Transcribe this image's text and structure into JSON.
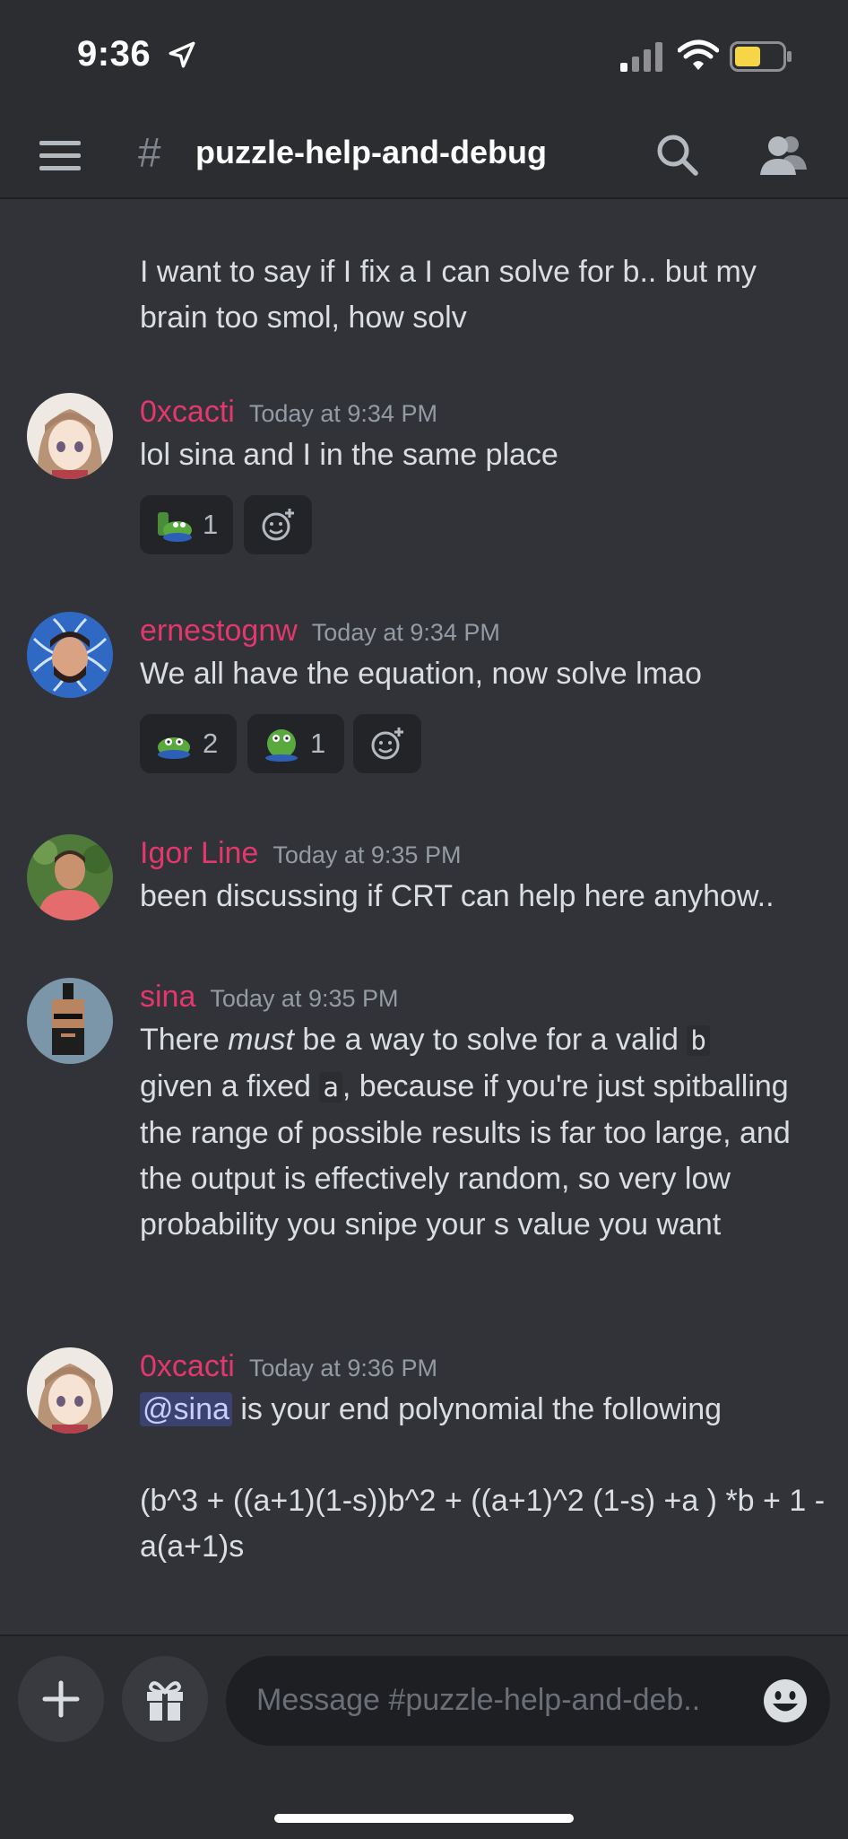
{
  "status_bar": {
    "time": "9:36"
  },
  "header": {
    "hash": "#",
    "channel_name": "puzzle-help-and-debug"
  },
  "messages": [
    {
      "text": "I want to say if I fix a I can solve for b.. but my brain too smol, how solv"
    },
    {
      "author": "0xcacti",
      "timestamp": "Today at 9:34 PM",
      "text": "lol sina and I in the same place",
      "reactions": [
        {
          "emoji": "frog-emoji",
          "count": "1"
        }
      ]
    },
    {
      "author": "ernestognw",
      "timestamp": "Today at 9:34 PM",
      "text": "We all have the equation, now solve lmao",
      "reactions": [
        {
          "emoji": "frog-emoji",
          "count": "2"
        },
        {
          "emoji": "frog-emoji",
          "count": "1"
        }
      ]
    },
    {
      "author": "Igor Line",
      "timestamp": "Today at 9:35 PM",
      "text": "been discussing if CRT can help here anyhow.."
    },
    {
      "author": "sina",
      "timestamp": "Today at 9:35 PM",
      "text_parts": {
        "p1": "There ",
        "em": "must",
        "p2": " be a way to solve for a valid ",
        "code1": "b",
        "p3": "given a fixed ",
        "code2": "a",
        "p4": ", because if you're just spitballing the range of possible results is far too large, and the output is effectively random, so very low probability you snipe your s value you want"
      }
    },
    {
      "author": "0xcacti",
      "timestamp": "Today at 9:36 PM",
      "mention": "@sina",
      "text": " is your end polynomial the following",
      "equation": "(b^3 + ((a+1)(1-s))b^2 + ((a+1)^2 (1-s) +a ) *b + 1 - a(a+1)s"
    }
  ],
  "composer": {
    "placeholder": "Message #puzzle-help-and-deb.."
  },
  "colors": {
    "background": "#313338",
    "header": "#2b2d31",
    "author": "#e3386c",
    "mention": "#3c4270"
  }
}
